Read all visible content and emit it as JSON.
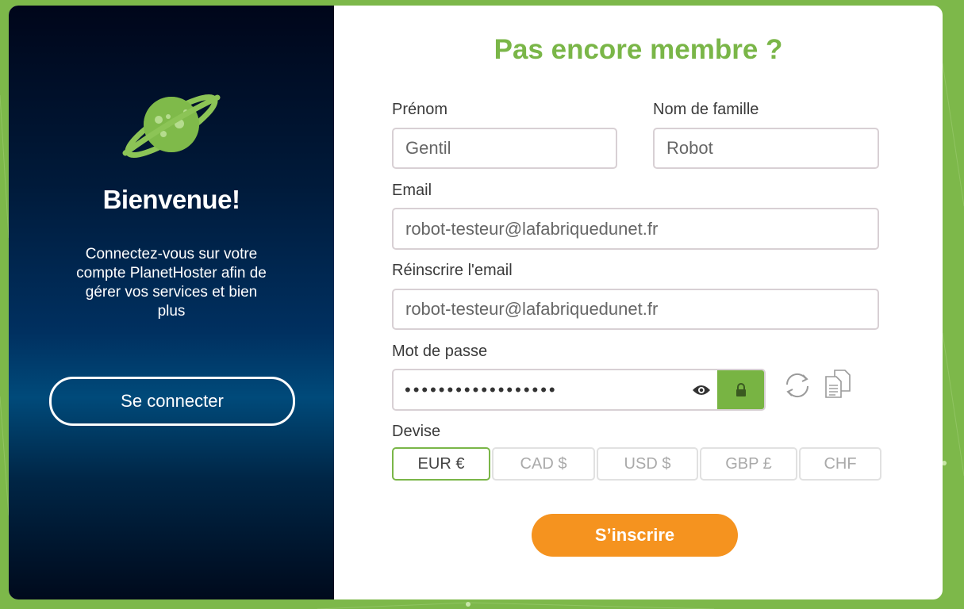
{
  "left_panel": {
    "welcome_title": "Bienvenue!",
    "welcome_text": "Connectez-vous sur votre compte PlanetHoster afin de gérer vos services et bien plus",
    "login_button": "Se connecter",
    "logo_icon": "planet-icon"
  },
  "form": {
    "title": "Pas encore membre ?",
    "first_name": {
      "label": "Prénom",
      "value": "Gentil"
    },
    "last_name": {
      "label": "Nom de famille",
      "value": "Robot"
    },
    "email": {
      "label": "Email",
      "value": "robot-testeur@lafabriquedunet.fr"
    },
    "email_confirm": {
      "label": "Réinscrire l'email",
      "value": "robot-testeur@lafabriquedunet.fr"
    },
    "password": {
      "label": "Mot de passe",
      "masked_value": "••••••••••••••••••",
      "icons": [
        "eye-icon",
        "lock-icon",
        "refresh-icon",
        "copy-icon"
      ]
    },
    "currency": {
      "label": "Devise",
      "options": [
        "EUR €",
        "CAD $",
        "USD $",
        "GBP £",
        "CHF"
      ],
      "selected": "EUR €"
    },
    "submit_button": "S’inscrire"
  },
  "colors": {
    "accent_green": "#7ab648",
    "submit_orange": "#f5931f",
    "background_green": "#7db84a"
  }
}
